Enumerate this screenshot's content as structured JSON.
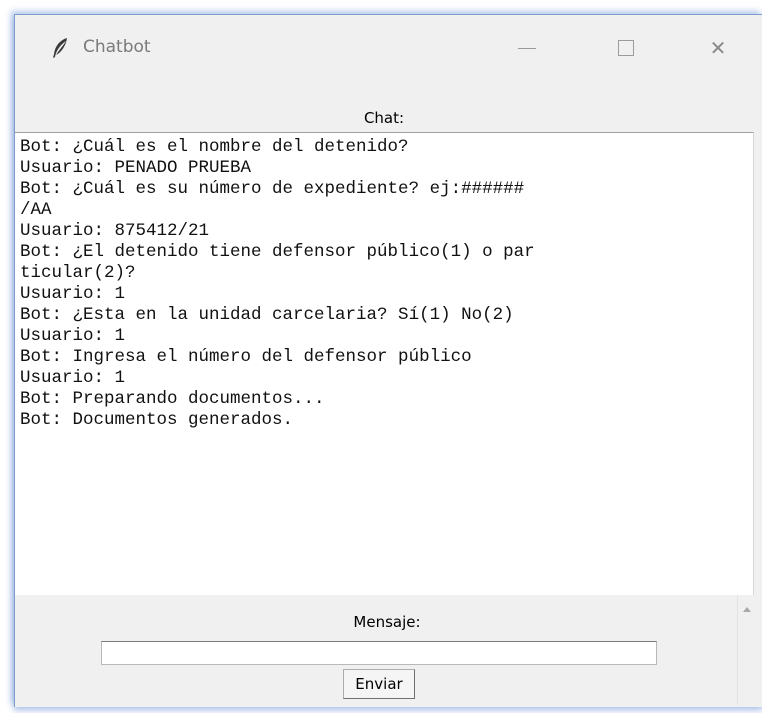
{
  "window": {
    "title": "Chatbot",
    "icon": "feather-icon",
    "controls": {
      "minimize": "—",
      "maximize": "☐",
      "close": "✕"
    }
  },
  "chat": {
    "label": "Chat:",
    "transcript": "Bot: ¿Cuál es el nombre del detenido?\nUsuario: PENADO PRUEBA\nBot: ¿Cuál es su número de expediente? ej:######\n/AA\nUsuario: 875412/21\nBot: ¿El detenido tiene defensor público(1) o par\nticular(2)?\nUsuario: 1\nBot: ¿Esta en la unidad carcelaria? Sí(1) No(2)\nUsuario: 1\nBot: Ingresa el número del defensor público\nUsuario: 1\nBot: Preparando documentos...\nBot: Documentos generados."
  },
  "message": {
    "label": "Mensaje:",
    "value": "",
    "send_label": "Enviar"
  }
}
